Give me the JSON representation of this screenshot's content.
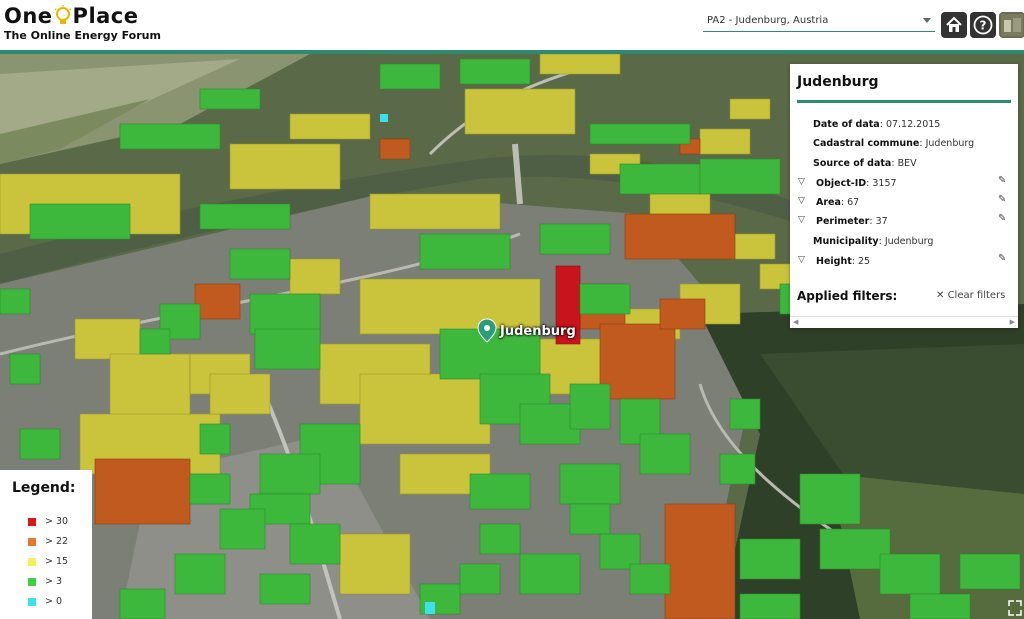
{
  "app": {
    "title_left": "One",
    "title_right": "Place",
    "subtitle": "The Online Energy Forum"
  },
  "location_select": {
    "value": "PA2 - Judenburg, Austria"
  },
  "header_buttons": [
    "home-icon",
    "help-icon",
    "user-avatar"
  ],
  "map": {
    "marker_label": "Judenburg"
  },
  "panel": {
    "title": "Judenburg",
    "rows": [
      {
        "label": "Date of data",
        "value": "07.12.2015",
        "filterable": false,
        "editable": false
      },
      {
        "label": "Cadastral commune",
        "value": "Judenburg",
        "filterable": false,
        "editable": false
      },
      {
        "label": "Source of data",
        "value": "BEV",
        "filterable": false,
        "editable": false
      },
      {
        "label": "Object-ID",
        "value": "3157",
        "filterable": true,
        "editable": true
      },
      {
        "label": "Area",
        "value": "67",
        "filterable": true,
        "editable": true
      },
      {
        "label": "Perimeter",
        "value": "37",
        "filterable": true,
        "editable": true
      },
      {
        "label": "Municipality",
        "value": "Judenburg",
        "filterable": false,
        "editable": false
      },
      {
        "label": "Height",
        "value": "25",
        "filterable": true,
        "editable": true
      }
    ],
    "applied_filters_label": "Applied filters:",
    "clear_filters_label": "Clear filters"
  },
  "legend": {
    "title": "Legend:",
    "items": [
      {
        "label": "> 30",
        "color": "#d7191c"
      },
      {
        "label": "> 22",
        "color": "#e8772e"
      },
      {
        "label": "> 15",
        "color": "#f1f15a"
      },
      {
        "label": "> 3",
        "color": "#3ed13e"
      },
      {
        "label": "> 0",
        "color": "#3ee0f0"
      }
    ]
  },
  "colors": {
    "accent": "#2e8b6e",
    "tall": "#c8141c",
    "high": "#c05a1e",
    "mid": "#c9c43c",
    "low": "#3db83d"
  }
}
